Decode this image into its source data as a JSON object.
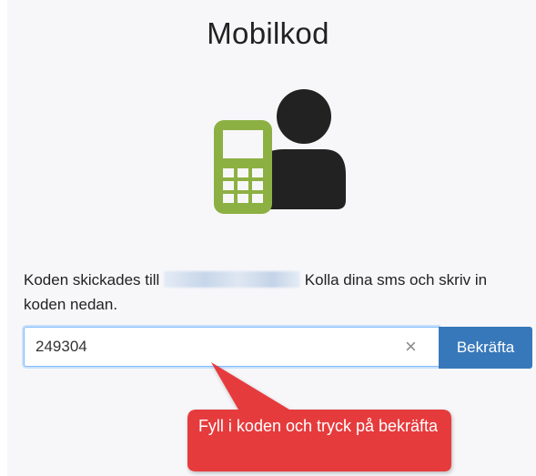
{
  "page": {
    "title": "Mobilkod",
    "message_before": "Koden skickades till",
    "message_after": "Kolla dina sms och skriv in koden nedan."
  },
  "form": {
    "code_value": "249304",
    "clear_symbol": "×",
    "confirm_label": "Bekräfta"
  },
  "annotation": {
    "callout_text": "Fyll i koden och tryck på bekräfta"
  },
  "icons": {
    "illustration": "mobile-phone-user-icon",
    "clear": "close-icon"
  },
  "colors": {
    "phone_green": "#8db043",
    "person_dark": "#222222",
    "button_blue": "#3778ba",
    "callout_red": "#e63b3d",
    "input_focus": "#80bdff"
  }
}
